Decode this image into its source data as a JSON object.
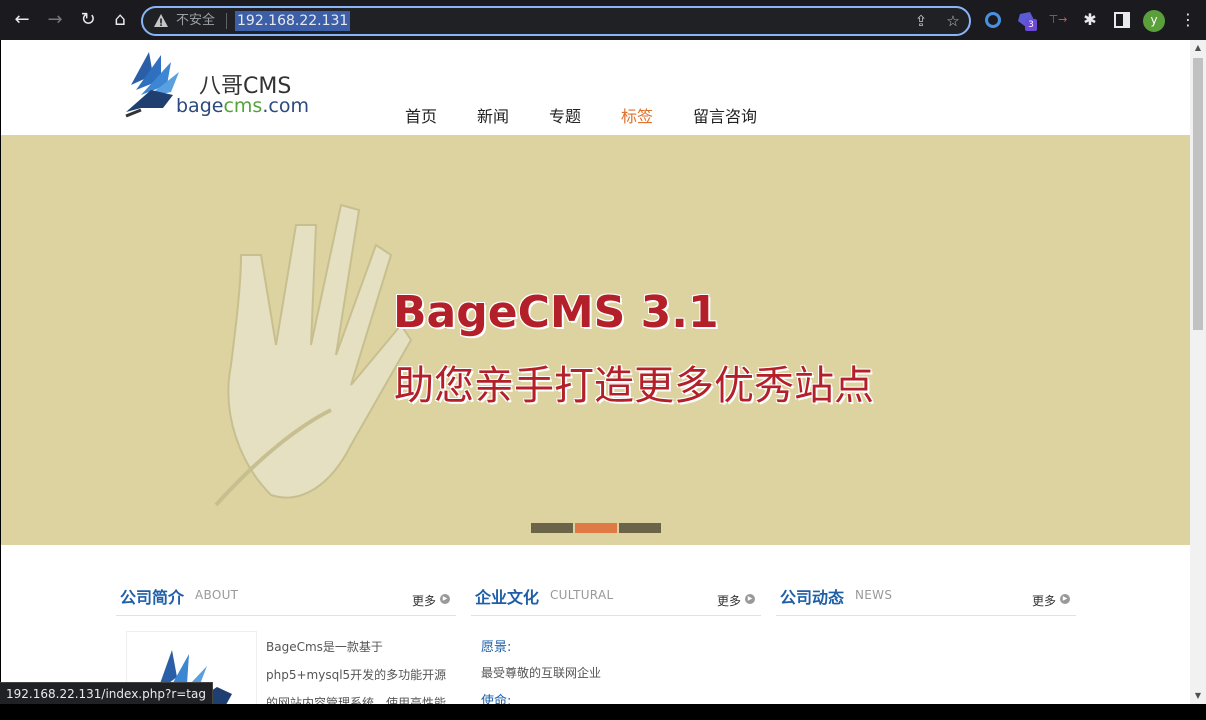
{
  "browser": {
    "nav": {
      "back": "←",
      "forward": "→",
      "reload": "↻",
      "home": "⌂"
    },
    "insecure_label": "不安全",
    "url": "192.168.22.131",
    "extensions": [
      "circle-ext-icon",
      "gem-ext-icon",
      "translate-ext-icon",
      "puzzle-ext-icon",
      "sidepanel-icon"
    ],
    "badge": "3",
    "profile_initial": "y",
    "status_url": "192.168.22.131/index.php?r=tag"
  },
  "site": {
    "logo_cn": "八哥CMS",
    "logo_en_a": "bage",
    "logo_en_b": "cms",
    "logo_en_c": ".com",
    "nav": [
      {
        "label": "首页",
        "active": false
      },
      {
        "label": "新闻",
        "active": false
      },
      {
        "label": "专题",
        "active": false
      },
      {
        "label": "标签",
        "active": true
      },
      {
        "label": "留言咨询",
        "active": false
      }
    ],
    "banner": {
      "title": "BageCMS 3.1",
      "subtitle": "助您亲手打造更多优秀站点",
      "slides": 3,
      "active_slide": 1
    },
    "columns": [
      {
        "title": "公司简介",
        "en": "ABOUT",
        "more": "更多"
      },
      {
        "title": "企业文化",
        "en": "CULTURAL",
        "more": "更多"
      },
      {
        "title": "公司动态",
        "en": "NEWS",
        "more": "更多"
      }
    ],
    "about_text": "BageCms是一款基于php5+mysql5开发的多功能开源的网站内容管理系统。使用高性能",
    "about_lines": [
      "BageCms是一款基于",
      "php5+mysql5开发的多功能开源",
      "的网站内容管理系统。使用高性能"
    ],
    "culture": {
      "vision_label": "愿景:",
      "vision_text": "最受尊敬的互联网企业",
      "mission_label": "使命:"
    }
  },
  "colors": {
    "accent": "#e0712c",
    "banner_bg": "#dcd3a0",
    "title_red": "#b3202a",
    "link_blue": "#1e5fa8"
  }
}
